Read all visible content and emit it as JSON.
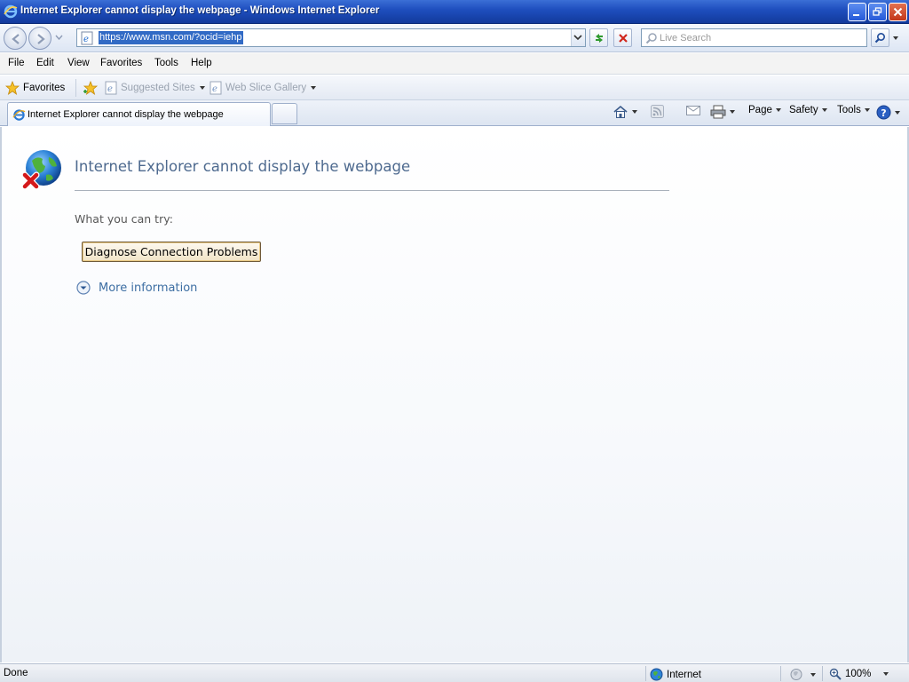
{
  "window": {
    "title": "Internet Explorer cannot display the webpage - Windows Internet Explorer"
  },
  "address_bar": {
    "url": "https://www.msn.com/?ocid=iehp"
  },
  "search": {
    "placeholder": "Live Search"
  },
  "menu": {
    "items": [
      "File",
      "Edit",
      "View",
      "Favorites",
      "Tools",
      "Help"
    ]
  },
  "favorites_bar": {
    "favorites_label": "Favorites",
    "suggested_sites": "Suggested Sites",
    "web_slice_gallery": "Web Slice Gallery"
  },
  "tab": {
    "label": "Internet Explorer cannot display the webpage"
  },
  "command_bar": {
    "page": "Page",
    "safety": "Safety",
    "tools": "Tools"
  },
  "content": {
    "heading": "Internet Explorer cannot display the webpage",
    "what_you_can_try": "What you can try:",
    "diagnose_button": "Diagnose Connection Problems",
    "more_information": "More information"
  },
  "status_bar": {
    "status": "Done",
    "zone": "Internet",
    "zoom": "100%"
  },
  "colors": {
    "titlebar": "#1f4fbf",
    "heading": "#4e6a8f",
    "link": "#3d6ea3",
    "url_highlight": "#316ac5"
  }
}
